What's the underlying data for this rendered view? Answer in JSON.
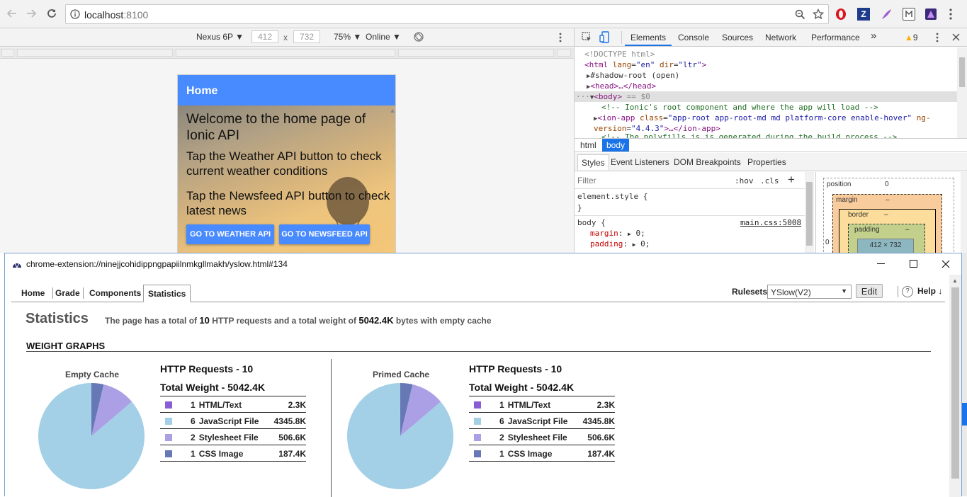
{
  "browser": {
    "url_host": "localhost",
    "url_port": ":8100",
    "icons": [
      "back-icon",
      "forward-icon",
      "reload-icon",
      "info-icon",
      "zoom-icon",
      "star-icon"
    ],
    "extensions": {
      "z_label": "Z"
    }
  },
  "device_toolbar": {
    "device": "Nexus 6P",
    "width": "412",
    "times": "x",
    "height": "732",
    "zoom": "75%",
    "network": "Online"
  },
  "app": {
    "header_title": "Home",
    "welcome": "Welcome to the home page of Ionic API",
    "weather_hint": "Tap the Weather API button to check current weather conditions",
    "news_hint": "Tap the Newsfeed API button to check latest news",
    "weather_button": "GO TO WEATHER API",
    "news_button": "GO TO NEWSFEED API"
  },
  "devtools": {
    "tabs": [
      "Elements",
      "Console",
      "Sources",
      "Network",
      "Performance"
    ],
    "more": "»",
    "warnings": "9",
    "dom": {
      "doctype": "<!DOCTYPE html>",
      "html_open": "<html",
      "html_lang_attr": "lang",
      "html_lang_val": "\"en\"",
      "html_dir_attr": "dir",
      "html_dir_val": "\"ltr\"",
      "shadow": "#shadow-root (open)",
      "head": "<head>…</head>",
      "body_tag": "<body>",
      "body_eq": "== $0",
      "comment": "<!-- Ionic's root component and where the app will load -->",
      "ionapp_tag": "<ion-app",
      "ionapp_class_attr": "class",
      "ionapp_class_val": "\"app-root app-root-md md platform-core enable-hover\"",
      "ionapp_ng": "ng-",
      "ionapp_version_attr": "version",
      "ionapp_version_val": "\"4.4.3\"",
      "ionapp_close": ">…</ion-app>",
      "polyfill_comment": "<!-- The polyfills js is generated during the build process -->"
    },
    "crumbs": [
      "html",
      "body"
    ],
    "subtabs": [
      "Styles",
      "Event Listeners",
      "DOM Breakpoints",
      "Properties"
    ],
    "filter_placeholder": "Filter",
    "hov": ":hov",
    "cls": ".cls",
    "add": "+",
    "element_style": "element.style {",
    "close_brace": "}",
    "body_selector": "body {",
    "source": "main.css:5008",
    "margin_prop": "margin",
    "margin_val": "0;",
    "padding_prop": "padding",
    "padding_val": "0;",
    "box": {
      "position": "position",
      "position_val": "0",
      "margin": "margin",
      "dash": "–",
      "border": "border",
      "padding": "padding",
      "content": "412 × 732",
      "zero": "0"
    }
  },
  "yslow": {
    "window_title": "chrome-extension://ninejjcohidippngpapiilnmkgllmakh/yslow.html#134",
    "tabs": [
      "Home",
      "Grade",
      "Components",
      "Statistics"
    ],
    "rulesets_label": "Rulesets",
    "ruleset_value": "YSlow(V2)",
    "edit_label": "Edit",
    "help_label": "Help",
    "help_q": "?",
    "help_arrow": "↓",
    "heading": "Statistics",
    "summary_pre": "The page has a total of",
    "summary_count": "10",
    "summary_mid": "HTTP requests and a total weight of",
    "summary_weight": "5042.4K",
    "summary_post": "bytes with empty cache",
    "weight_graphs": "WEIGHT GRAPHS",
    "empty": {
      "pie_title": "Empty Cache",
      "requests": "HTTP Requests - 10",
      "weight": "Total Weight - 5042.4K",
      "rows": [
        {
          "count": "1",
          "type": "HTML/Text",
          "size": "2.3K",
          "color": "#8a5cd6"
        },
        {
          "count": "6",
          "type": "JavaScript File",
          "size": "4345.8K",
          "color": "#a3d0e6"
        },
        {
          "count": "2",
          "type": "Stylesheet File",
          "size": "506.6K",
          "color": "#ab9fe6"
        },
        {
          "count": "1",
          "type": "CSS Image",
          "size": "187.4K",
          "color": "#6678b5"
        }
      ]
    },
    "primed": {
      "pie_title": "Primed Cache",
      "requests": "HTTP Requests - 10",
      "weight": "Total Weight - 5042.4K",
      "rows": [
        {
          "count": "1",
          "type": "HTML/Text",
          "size": "2.3K",
          "color": "#8a5cd6"
        },
        {
          "count": "6",
          "type": "JavaScript File",
          "size": "4345.8K",
          "color": "#a3d0e6"
        },
        {
          "count": "2",
          "type": "Stylesheet File",
          "size": "506.6K",
          "color": "#ab9fe6"
        },
        {
          "count": "1",
          "type": "CSS Image",
          "size": "187.4K",
          "color": "#6678b5"
        }
      ]
    }
  },
  "chart_data": [
    {
      "type": "pie",
      "title": "Empty Cache",
      "categories": [
        "HTML/Text",
        "JavaScript File",
        "Stylesheet File",
        "CSS Image"
      ],
      "values": [
        2.3,
        4345.8,
        506.6,
        187.4
      ],
      "units": "K"
    },
    {
      "type": "pie",
      "title": "Primed Cache",
      "categories": [
        "HTML/Text",
        "JavaScript File",
        "Stylesheet File",
        "CSS Image"
      ],
      "values": [
        2.3,
        4345.8,
        506.6,
        187.4
      ],
      "units": "K"
    }
  ]
}
